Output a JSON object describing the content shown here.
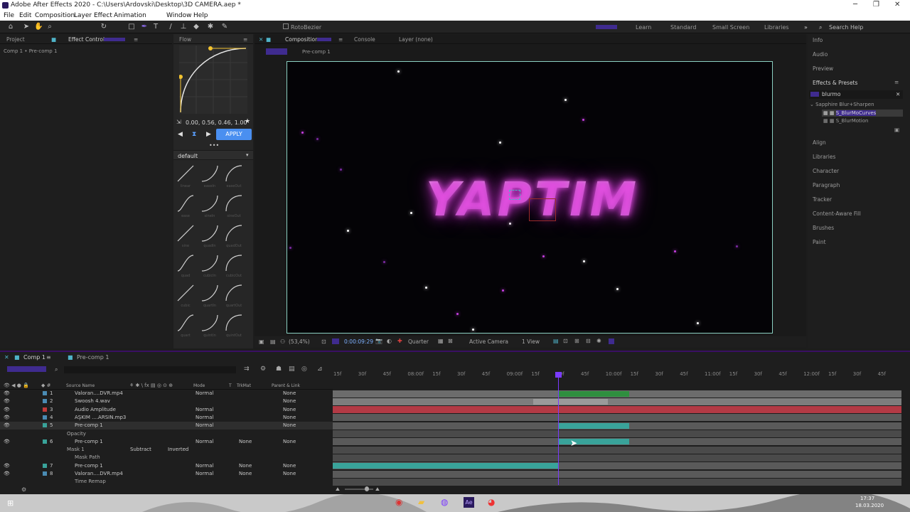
{
  "window": {
    "title": "Adobe After Effects 2020 - C:\\Users\\Ardovski\\Desktop\\3D CAMERA.aep *",
    "minimize": "─",
    "maximize": "❐",
    "close": "✕"
  },
  "menu": [
    "File",
    "Edit",
    "Composition",
    "Layer",
    "Effect",
    "Animation",
    "Window",
    "Help"
  ],
  "toolbar": {
    "rotobezier": "RotoBezier",
    "workspaces": [
      "Learn",
      "Standard",
      "Small Screen",
      "Libraries"
    ],
    "search": "Search Help"
  },
  "project_panel": {
    "tabs": [
      "Project",
      "Effect Controls"
    ],
    "subtitle": "Comp 1 • Pre-comp 1"
  },
  "flow": {
    "tab": "Flow",
    "values": "0.00, 0.56, 0.46, 1.00",
    "apply": "APPLY",
    "preset": "default",
    "ease_labels": [
      "linear",
      "easeIn",
      "easeOut",
      "ease",
      "sineIn",
      "sineOut",
      "sine",
      "quadIn",
      "quadOut",
      "quad",
      "cubicIn",
      "cubicOut",
      "cubic",
      "quartIn",
      "quartOut",
      "quart",
      "quintIn",
      "quintOut"
    ]
  },
  "comp_panel": {
    "tabs": [
      "Composition",
      "Console",
      "Layer (none)"
    ],
    "breadcrumb": "Pre-comp 1",
    "text": "YAPTIM"
  },
  "viewer_bar": {
    "zoom": "(53,4%)",
    "time": "0:00:09:29",
    "resolution": "Quarter",
    "camera": "Active Camera",
    "views": "1 View"
  },
  "right_panel": {
    "items_top": [
      "Info",
      "Audio",
      "Preview",
      "Effects & Presets"
    ],
    "search": "blurmo",
    "folder": "Sapphire Blur+Sharpen",
    "effects": [
      "S_BlurMoCurves",
      "S_BlurMotion"
    ],
    "items_bottom": [
      "Align",
      "Libraries",
      "Character",
      "Paragraph",
      "Tracker",
      "Content-Aware Fill",
      "Brushes",
      "Paint"
    ]
  },
  "timeline": {
    "tabs": [
      "Comp 1",
      "Pre-comp 1"
    ],
    "columns": {
      "source": "Source Name",
      "mode": "Mode",
      "t": "T",
      "trkmat": "TrkMat",
      "parent": "Parent & Link"
    },
    "ruler": [
      "15f",
      "30f",
      "45f",
      "08:00f",
      "15f",
      "30f",
      "45f",
      "09:00f",
      "15f",
      "30f",
      "45f",
      "10:00f",
      "15f",
      "30f",
      "45f",
      "11:00f",
      "15f",
      "30f",
      "45f",
      "12:00f",
      "15f",
      "30f",
      "45f"
    ],
    "layers": [
      {
        "num": "1",
        "name": "Valoran....DVR.mp4",
        "mode": "Normal",
        "trkmat": "",
        "parent": "None",
        "color": "#4a8bb3"
      },
      {
        "num": "2",
        "name": "Swoosh 4.wav",
        "mode": "",
        "trkmat": "",
        "parent": "None",
        "color": "#4a8bb3"
      },
      {
        "num": "3",
        "name": "Audio Amplitude",
        "mode": "Normal",
        "trkmat": "",
        "parent": "None",
        "color": "#c23a3a"
      },
      {
        "num": "4",
        "name": "AŞKIM ....ARSIN.mp3",
        "mode": "Normal",
        "trkmat": "",
        "parent": "None",
        "color": "#4a8bb3"
      },
      {
        "num": "5",
        "name": "Pre-comp 1",
        "mode": "Normal",
        "trkmat": "",
        "parent": "None",
        "color": "#39a39a"
      },
      {
        "num": "",
        "name": "Opacity",
        "mode": "",
        "trkmat": "",
        "parent": "",
        "color": ""
      },
      {
        "num": "6",
        "name": "Pre-comp 1",
        "mode": "Normal",
        "trkmat": "None",
        "parent": "None",
        "color": "#39a39a"
      },
      {
        "num": "",
        "name": "Mask 1",
        "mode": "Subtract",
        "trkmat": "Inverted",
        "parent": "",
        "color": "#3aa0d8"
      },
      {
        "num": "",
        "name": "Mask Path",
        "mode": "",
        "trkmat": "",
        "parent": "",
        "color": ""
      },
      {
        "num": "7",
        "name": "Pre-comp 1",
        "mode": "Normal",
        "trkmat": "None",
        "parent": "None",
        "color": "#39a39a"
      },
      {
        "num": "8",
        "name": "Valoran....DVR.mp4",
        "mode": "Normal",
        "trkmat": "None",
        "parent": "None",
        "color": "#4a8bb3"
      },
      {
        "num": "",
        "name": "Time Remap",
        "mode": "",
        "trkmat": "",
        "parent": "",
        "color": ""
      }
    ]
  },
  "taskbar": {
    "time": "17:37",
    "date": "18.03.2020"
  },
  "colors": {
    "accent": "#3f2b8f",
    "comp_border": "#8bd0c2",
    "text_pink": "#e26fe6",
    "apply": "#4a8ff0"
  }
}
